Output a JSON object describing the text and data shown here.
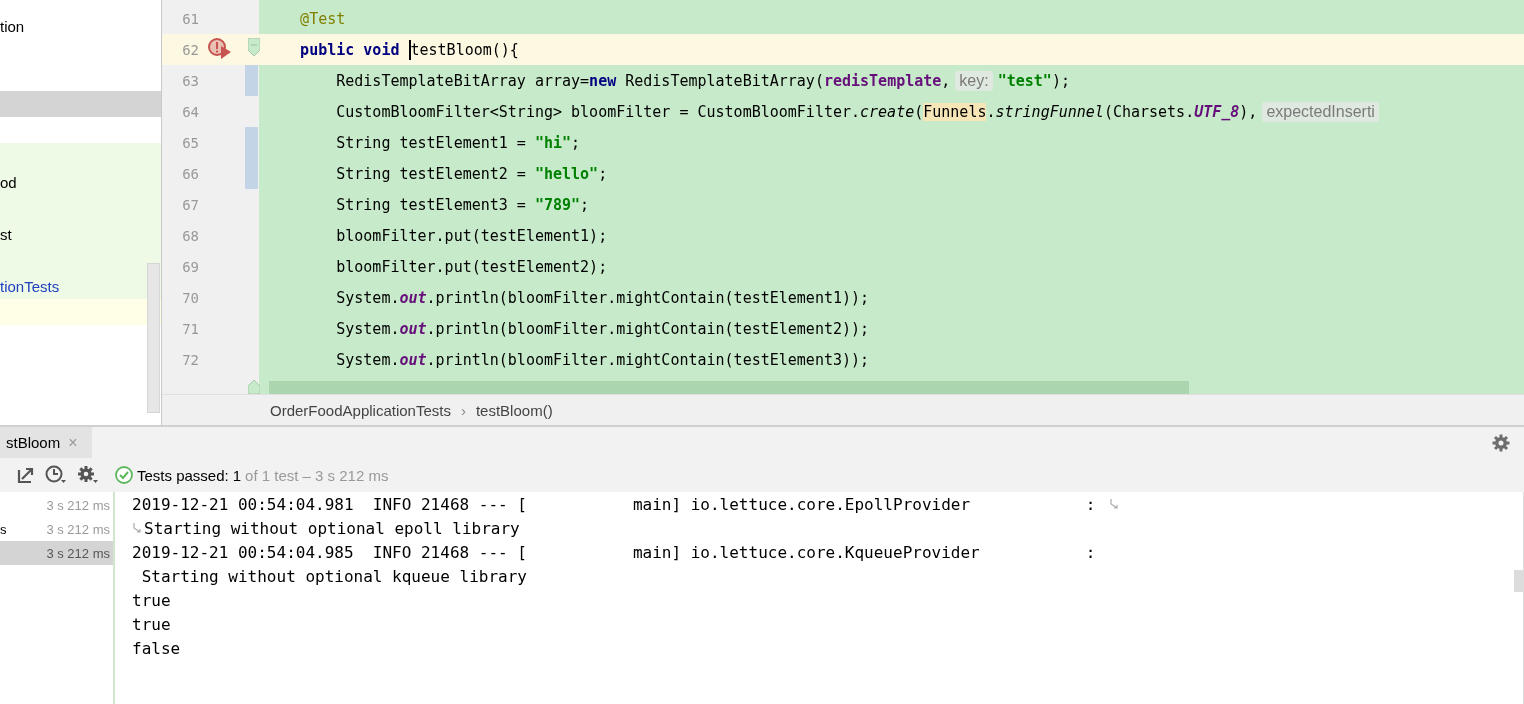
{
  "project_tree": {
    "rows": [
      {
        "label": "tion",
        "kind": "plain",
        "selected": false,
        "modified": false
      },
      {
        "kind": "plain",
        "selected": false
      },
      {
        "kind": "plain",
        "selected": false
      },
      {
        "kind": "plain",
        "selected": true
      },
      {
        "kind": "plain",
        "selected": false
      },
      {
        "kind": "test",
        "selected": false
      },
      {
        "label": "od",
        "kind": "test",
        "selected": false,
        "modified": false
      },
      {
        "kind": "test",
        "selected": false
      },
      {
        "label": "st",
        "kind": "test",
        "selected": false,
        "modified": false
      },
      {
        "kind": "test",
        "selected": false
      },
      {
        "label": "tionTests",
        "kind": "test",
        "selected": false,
        "modified": true
      },
      {
        "kind": "current",
        "selected": false
      }
    ]
  },
  "editor": {
    "lines": [
      {
        "number": "61",
        "current": false,
        "changed": false,
        "runnable": false,
        "fold_start": false,
        "segments": [
          {
            "kind": "code",
            "tokens": [
              {
                "kind": "annotation",
                "text": "    @Test"
              }
            ]
          }
        ]
      },
      {
        "number": "62",
        "current": true,
        "changed": false,
        "runnable": true,
        "fold_start": true,
        "segments": [
          {
            "kind": "code",
            "tokens": [
              {
                "kind": "keyword",
                "text": "    public void "
              }
            ]
          },
          {
            "kind": "caret"
          },
          {
            "kind": "code",
            "tokens": [
              {
                "kind": "plain",
                "text": "testBloom(){"
              }
            ]
          }
        ]
      },
      {
        "number": "63",
        "current": false,
        "changed": true,
        "runnable": false,
        "fold_start": false,
        "segments": [
          {
            "kind": "code",
            "tokens": [
              {
                "kind": "plain",
                "text": "        RedisTemplateBitArray array="
              },
              {
                "kind": "keyword",
                "text": "new"
              },
              {
                "kind": "plain",
                "text": " RedisTemplateBitArray("
              },
              {
                "kind": "field",
                "text": "redisTemplate"
              },
              {
                "kind": "plain",
                "text": ","
              }
            ]
          },
          {
            "kind": "hint",
            "text": "key:"
          },
          {
            "kind": "code",
            "tokens": [
              {
                "kind": "string",
                "text": "\"test\""
              },
              {
                "kind": "plain",
                "text": ");"
              }
            ]
          }
        ]
      },
      {
        "number": "64",
        "current": false,
        "changed": false,
        "runnable": false,
        "fold_start": false,
        "segments": [
          {
            "kind": "code",
            "tokens": [
              {
                "kind": "plain",
                "text": "        CustomBloomFilter<String> bloomFilter = CustomBloomFilter."
              },
              {
                "kind": "static",
                "text": "create"
              },
              {
                "kind": "plain",
                "text": "("
              },
              {
                "kind": "highlight",
                "text": "Funnels"
              },
              {
                "kind": "plain",
                "text": "."
              },
              {
                "kind": "static",
                "text": "stringFunnel"
              },
              {
                "kind": "plain",
                "text": "(Charsets."
              },
              {
                "kind": "static_field",
                "text": "UTF_8"
              },
              {
                "kind": "plain",
                "text": "),"
              }
            ]
          },
          {
            "kind": "hint",
            "text": "expectedInserti"
          }
        ]
      },
      {
        "number": "65",
        "current": false,
        "changed": true,
        "runnable": false,
        "fold_start": false,
        "segments": [
          {
            "kind": "code",
            "tokens": [
              {
                "kind": "plain",
                "text": "        String testElement1 = "
              },
              {
                "kind": "string",
                "text": "\"hi\""
              },
              {
                "kind": "plain",
                "text": ";"
              }
            ]
          }
        ]
      },
      {
        "number": "66",
        "current": false,
        "changed": true,
        "runnable": false,
        "fold_start": false,
        "segments": [
          {
            "kind": "code",
            "tokens": [
              {
                "kind": "plain",
                "text": "        String testElement2 = "
              },
              {
                "kind": "string",
                "text": "\"hello\""
              },
              {
                "kind": "plain",
                "text": ";"
              }
            ]
          }
        ]
      },
      {
        "number": "67",
        "current": false,
        "changed": false,
        "runnable": false,
        "fold_start": false,
        "segments": [
          {
            "kind": "code",
            "tokens": [
              {
                "kind": "plain",
                "text": "        String testElement3 = "
              },
              {
                "kind": "string",
                "text": "\"789\""
              },
              {
                "kind": "plain",
                "text": ";"
              }
            ]
          }
        ]
      },
      {
        "number": "68",
        "current": false,
        "changed": false,
        "runnable": false,
        "fold_start": false,
        "segments": [
          {
            "kind": "code",
            "tokens": [
              {
                "kind": "plain",
                "text": "        bloomFilter.put(testElement1);"
              }
            ]
          }
        ]
      },
      {
        "number": "69",
        "current": false,
        "changed": false,
        "runnable": false,
        "fold_start": false,
        "segments": [
          {
            "kind": "code",
            "tokens": [
              {
                "kind": "plain",
                "text": "        bloomFilter.put(testElement2);"
              }
            ]
          }
        ]
      },
      {
        "number": "70",
        "current": false,
        "changed": false,
        "runnable": false,
        "fold_start": false,
        "segments": [
          {
            "kind": "code",
            "tokens": [
              {
                "kind": "plain",
                "text": "        System."
              },
              {
                "kind": "static_field",
                "text": "out"
              },
              {
                "kind": "plain",
                "text": ".println(bloomFilter.mightContain(testElement1));"
              }
            ]
          }
        ]
      },
      {
        "number": "71",
        "current": false,
        "changed": false,
        "runnable": false,
        "fold_start": false,
        "segments": [
          {
            "kind": "code",
            "tokens": [
              {
                "kind": "plain",
                "text": "        System."
              },
              {
                "kind": "static_field",
                "text": "out"
              },
              {
                "kind": "plain",
                "text": ".println(bloomFilter.mightContain(testElement2));"
              }
            ]
          }
        ]
      },
      {
        "number": "72",
        "current": false,
        "changed": false,
        "runnable": false,
        "fold_start": false,
        "segments": [
          {
            "kind": "code",
            "tokens": [
              {
                "kind": "plain",
                "text": "        System."
              },
              {
                "kind": "static_field",
                "text": "out"
              },
              {
                "kind": "plain",
                "text": ".println(bloomFilter.mightContain(testElement3));"
              }
            ]
          }
        ]
      }
    ],
    "breadcrumbs": [
      {
        "kind": "crumb",
        "text": "OrderFoodApplicationTests"
      },
      {
        "kind": "separator",
        "text": "›"
      },
      {
        "kind": "crumb",
        "text": "testBloom()"
      }
    ]
  },
  "run_panel": {
    "tab": {
      "label": "stBloom",
      "close": "×"
    },
    "status": {
      "label": "Tests passed:",
      "count": "1",
      "detail": "of 1 test – 3 s 212 ms"
    },
    "results": [
      {
        "time": "3 s 212 ms",
        "selected": false
      },
      {
        "label": "s",
        "time": "3 s 212 ms",
        "selected": false
      },
      {
        "time": "3 s 212 ms",
        "selected": true
      }
    ],
    "console": [
      {
        "text": "2019-12-21 00:54:04.981  INFO 21468 --- [           main] io.lettuce.core.EpollProvider            :",
        "kind": "wrap_end"
      },
      {
        "text": "Starting without optional epoll library",
        "kind": "wrap_start"
      },
      {
        "text": "2019-12-21 00:54:04.985  INFO 21468 --- [           main] io.lettuce.core.KqueueProvider           :",
        "kind": "plain"
      },
      {
        "text": " Starting without optional kqueue library",
        "kind": "plain"
      },
      {
        "text": "true",
        "kind": "plain"
      },
      {
        "text": "true",
        "kind": "plain"
      },
      {
        "text": "false",
        "kind": "plain"
      }
    ]
  }
}
